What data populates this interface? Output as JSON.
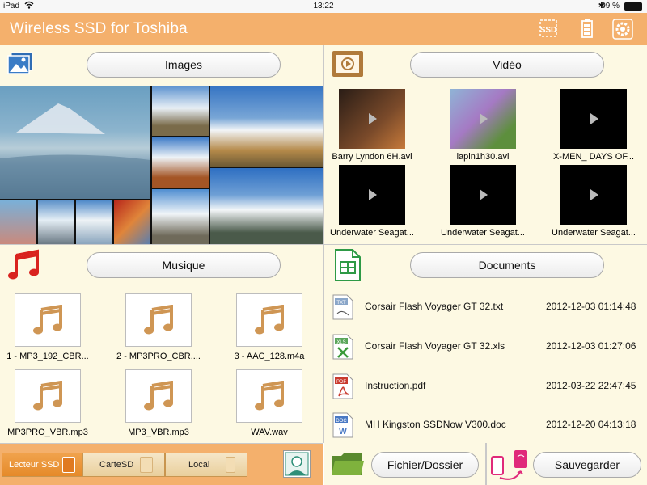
{
  "status": {
    "device": "iPad",
    "time": "13:22",
    "battery": "99 %"
  },
  "app": {
    "title": "Wireless SSD for Toshiba"
  },
  "sections": {
    "images": {
      "label": "Images"
    },
    "video": {
      "label": "Vidéo",
      "items": [
        {
          "caption": "Barry Lyndon 6H.avi"
        },
        {
          "caption": "lapin1h30.avi"
        },
        {
          "caption": "X-MEN_ DAYS OF..."
        },
        {
          "caption": "Underwater Seagat..."
        },
        {
          "caption": "Underwater Seagat..."
        },
        {
          "caption": "Underwater Seagat..."
        }
      ]
    },
    "music": {
      "label": "Musique",
      "items": [
        {
          "caption": "1 - MP3_192_CBR..."
        },
        {
          "caption": "2 - MP3PRO_CBR...."
        },
        {
          "caption": "3 - AAC_128.m4a"
        },
        {
          "caption": "MP3PRO_VBR.mp3"
        },
        {
          "caption": "MP3_VBR.mp3"
        },
        {
          "caption": "WAV.wav"
        }
      ]
    },
    "documents": {
      "label": "Documents",
      "items": [
        {
          "type": "TXT",
          "name": "Corsair Flash Voyager GT 32.txt",
          "date": "2012-12-03 01:14:48"
        },
        {
          "type": "XLS",
          "name": "Corsair Flash Voyager GT 32.xls",
          "date": "2012-12-03 01:27:06"
        },
        {
          "type": "PDF",
          "name": "Instruction.pdf",
          "date": "2012-03-22 22:47:45"
        },
        {
          "type": "DOC",
          "name": "MH Kingston SSDNow V300.doc",
          "date": "2012-12-20 04:13:18"
        }
      ]
    }
  },
  "bottom": {
    "tabs": [
      {
        "label": "Lecteur SSD",
        "active": true
      },
      {
        "label": "CarteSD",
        "active": false
      },
      {
        "label": "Local",
        "active": false
      }
    ],
    "folder_button": "Fichier/Dossier",
    "save_button": "Sauvegarder"
  }
}
